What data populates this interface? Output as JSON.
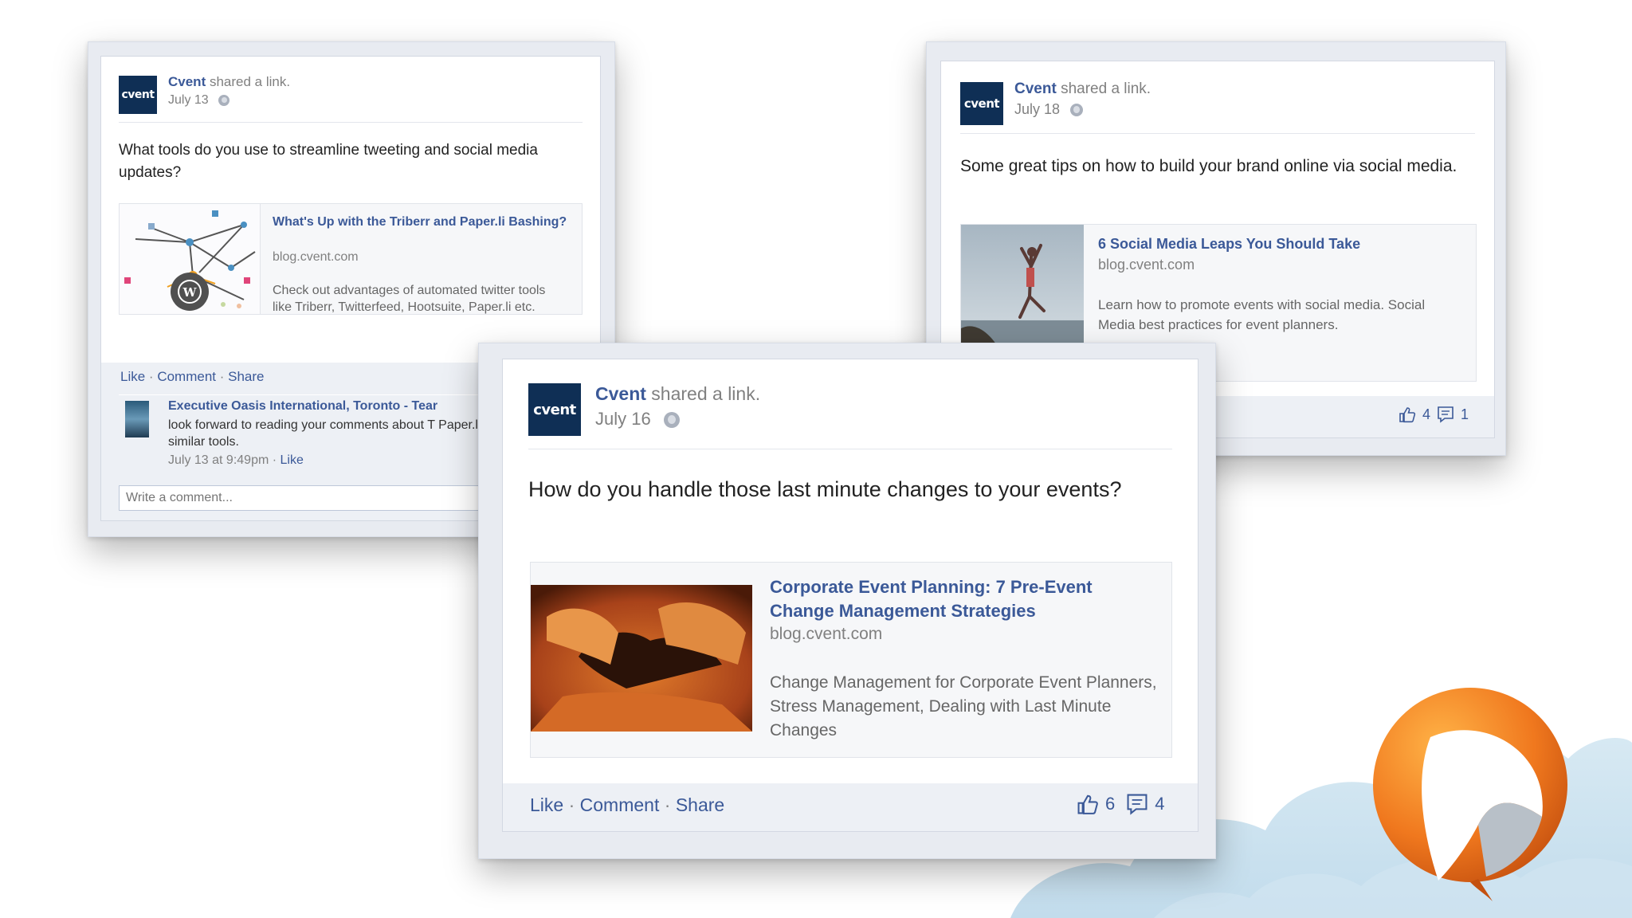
{
  "colors": {
    "brand": "#3b5998",
    "avatar_bg": "#0f2f55",
    "accent_orange": "#f0781e"
  },
  "avatar_text": "cvent",
  "post1": {
    "author": "Cvent",
    "action": "shared a link.",
    "date": "July 13",
    "message": "What tools do you use to streamline tweeting and social media updates?",
    "link_title": "What's Up with the Triberr and Paper.li Bashing?",
    "link_domain": "blog.cvent.com",
    "link_desc": "Check out advantages of automated twitter tools like Triberr, Twitterfeed, Hootsuite, Paper.li etc.",
    "actions": {
      "like": "Like",
      "comment": "Comment",
      "share": "Share"
    },
    "comment": {
      "author": "Executive Oasis International, Toronto - Tear",
      "text": "look forward to reading your comments about T Paper.li and similar tools.",
      "time": "July 13 at 9:49pm",
      "like": "Like"
    },
    "comment_placeholder": "Write a comment..."
  },
  "post2": {
    "author": "Cvent",
    "action": "shared a link.",
    "date": "July 18",
    "message": "Some great tips on how to build your brand online via social media.",
    "link_title": "6 Social Media Leaps You Should Take",
    "link_domain": "blog.cvent.com",
    "link_desc": "Learn how to promote events with social media. Social Media best practices for event planners.",
    "likes": "4",
    "comments": "1"
  },
  "post3": {
    "author": "Cvent",
    "action": "shared a link.",
    "date": "July 16",
    "message": "How do you handle those last minute changes to your events?",
    "link_title": "Corporate Event Planning: 7 Pre-Event Change Management Strategies",
    "link_domain": "blog.cvent.com",
    "link_desc": "Change Management for Corporate Event Planners, Stress Management, Dealing with Last Minute Changes",
    "actions": {
      "like": "Like",
      "comment": "Comment",
      "share": "Share"
    },
    "likes": "6",
    "comments": "4"
  }
}
